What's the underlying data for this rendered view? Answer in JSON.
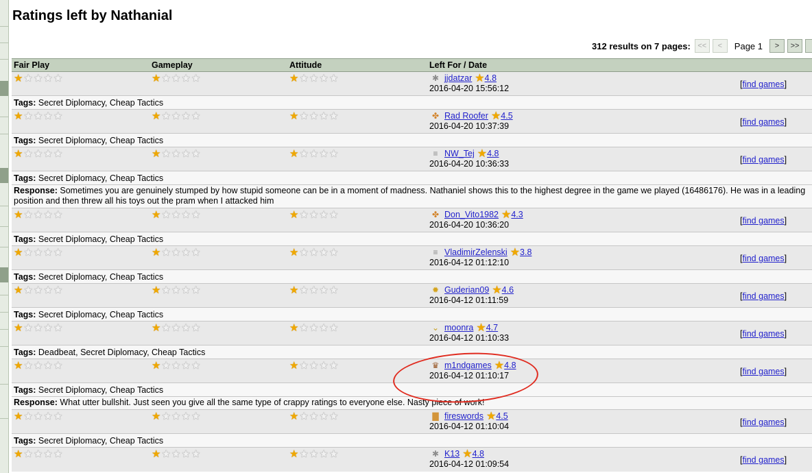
{
  "page": {
    "title": "Ratings left by Nathanial"
  },
  "pager": {
    "summary": "312 results on 7 pages:",
    "first": "<<",
    "prev": "<",
    "page_label": "Page 1",
    "next": ">",
    "last": ">>"
  },
  "table": {
    "headers": [
      "Fair Play",
      "Gameplay",
      "Attitude",
      "Left For / Date"
    ],
    "tags_label": "Tags:",
    "response_label": "Response:",
    "find_games_label": "find games",
    "max_stars": 5
  },
  "colors": {
    "header_bg": "#c4d1bf",
    "row_bg": "#e9e9e9",
    "star_on": "#f0a800",
    "link": "#2222cc",
    "annotation": "#e02b1f"
  },
  "rows": [
    {
      "fair": 1,
      "gameplay": 1,
      "attitude": 1,
      "user": "jjdatzar",
      "level": "4.8",
      "date": "2016-04-20 15:56:12",
      "rank_icon": "gear-icon",
      "tags": "Secret Diplomacy, Cheap Tactics",
      "response": ""
    },
    {
      "fair": 1,
      "gameplay": 1,
      "attitude": 1,
      "user": "Rad Roofer",
      "level": "4.5",
      "date": "2016-04-20 10:37:39",
      "rank_icon": "wings-icon",
      "tags": "Secret Diplomacy, Cheap Tactics",
      "response": ""
    },
    {
      "fair": 1,
      "gameplay": 1,
      "attitude": 1,
      "user": "NW_Tej",
      "level": "4.8",
      "date": "2016-04-20 10:36:33",
      "rank_icon": "chevrons-icon",
      "tags": "Secret Diplomacy, Cheap Tactics",
      "response": "Sometimes you are genuinely stumped by how stupid someone can be in a moment of madness. Nathaniel shows this to the highest degree in the game we played (16486176). He was in a leading position and then threw all his toys out the pram when I attacked him"
    },
    {
      "fair": 1,
      "gameplay": 1,
      "attitude": 1,
      "user": "Don_Vito1982",
      "level": "4.3",
      "date": "2016-04-20 10:36:20",
      "rank_icon": "wings-icon",
      "tags": "Secret Diplomacy, Cheap Tactics",
      "response": ""
    },
    {
      "fair": 1,
      "gameplay": 1,
      "attitude": 1,
      "user": "VladimirZelenski",
      "level": "3.8",
      "date": "2016-04-12 01:12:10",
      "rank_icon": "chevrons-icon",
      "tags": "Secret Diplomacy, Cheap Tactics",
      "response": ""
    },
    {
      "fair": 1,
      "gameplay": 1,
      "attitude": 1,
      "user": "Guderian09",
      "level": "4.6",
      "date": "2016-04-12 01:11:59",
      "rank_icon": "star-badge-icon",
      "tags": "Secret Diplomacy, Cheap Tactics",
      "response": ""
    },
    {
      "fair": 1,
      "gameplay": 1,
      "attitude": 1,
      "user": "moonra",
      "level": "4.7",
      "date": "2016-04-12 01:10:33",
      "rank_icon": "chevron-icon",
      "tags": "Deadbeat, Secret Diplomacy, Cheap Tactics",
      "response": ""
    },
    {
      "fair": 1,
      "gameplay": 1,
      "attitude": 1,
      "user": "m1ndgames",
      "level": "4.8",
      "date": "2016-04-12 01:10:17",
      "rank_icon": "crest-icon",
      "tags": "Secret Diplomacy, Cheap Tactics",
      "response": "What utter bullshit. Just seen you give all the same type of crappy ratings to everyone else. Nasty piece of work!"
    },
    {
      "fair": 1,
      "gameplay": 1,
      "attitude": 1,
      "user": "fireswords",
      "level": "4.5",
      "date": "2016-04-12 01:10:04",
      "rank_icon": "book-icon",
      "tags": "Secret Diplomacy, Cheap Tactics",
      "response": ""
    },
    {
      "fair": 1,
      "gameplay": 1,
      "attitude": 1,
      "user": "K13",
      "level": "4.8",
      "date": "2016-04-12 01:09:54",
      "rank_icon": "gear-icon",
      "tags": "",
      "response": ""
    }
  ]
}
